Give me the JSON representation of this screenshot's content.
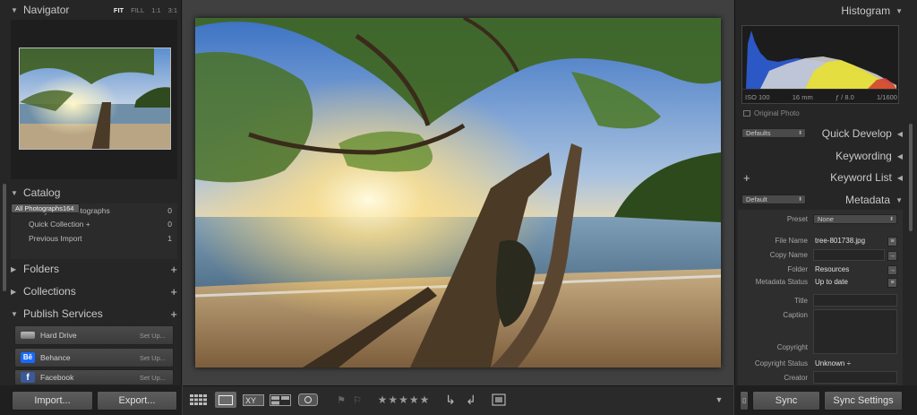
{
  "navigator": {
    "title": "Navigator",
    "opts": [
      "FIT",
      "FILL",
      "1:1",
      "3:1"
    ]
  },
  "catalog": {
    "title": "Catalog",
    "items": [
      {
        "label": "All Photographs",
        "count": "164"
      },
      {
        "label": "All Synced Photographs",
        "count": "0"
      },
      {
        "label": "Quick Collection +",
        "count": "0"
      },
      {
        "label": "Previous Import",
        "count": "1"
      }
    ]
  },
  "sections": {
    "folders": "Folders",
    "collections": "Collections",
    "publish": "Publish Services",
    "plus": "+"
  },
  "publish": {
    "items": [
      {
        "label": "Hard Drive",
        "action": "Set Up..."
      },
      {
        "label": "Behance",
        "action": "Set Up...",
        "badge": "Bē"
      },
      {
        "label": "Facebook",
        "action": "Set Up...",
        "badge": "f"
      }
    ]
  },
  "buttons": {
    "import": "Import...",
    "export": "Export...",
    "sync": "Sync",
    "sync_settings": "Sync Settings"
  },
  "histogram": {
    "title": "Histogram",
    "iso": "ISO 100",
    "focal": "16 mm",
    "aperture": "ƒ / 8.0",
    "shutter": "1/1600",
    "original": "Original Photo"
  },
  "panels": {
    "defaults": "Defaults",
    "quick_develop": "Quick Develop",
    "keywording": "Keywording",
    "keyword_list": "Keyword List",
    "metadata": "Metadata",
    "default": "Default",
    "plus": "+"
  },
  "metadata": {
    "preset_label": "Preset",
    "preset_value": "None",
    "file_name_label": "File Name",
    "file_name": "tree-801738.jpg",
    "copy_name_label": "Copy Name",
    "folder_label": "Folder",
    "folder": "Resources",
    "status_label": "Metadata Status",
    "status": "Up to date",
    "title_label": "Title",
    "caption_label": "Caption",
    "copyright_label": "Copyright",
    "copyright_status_label": "Copyright Status",
    "copyright_status": "Unknown ÷",
    "creator_label": "Creator"
  },
  "colors": {
    "accent": "#5a5a5a",
    "panel": "#262626"
  }
}
